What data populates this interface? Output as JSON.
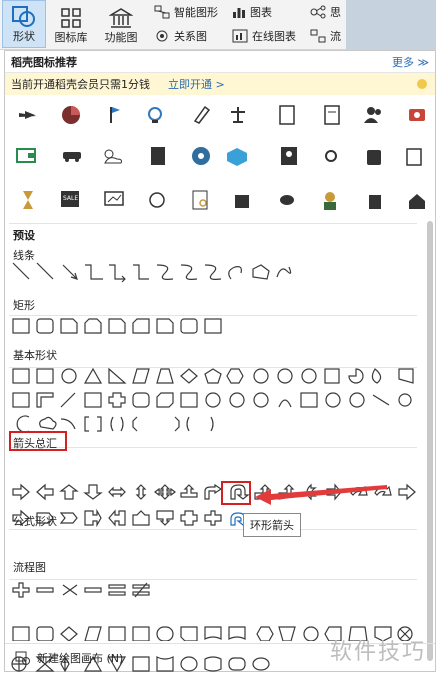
{
  "ribbon": {
    "shape_label": "形状",
    "iconlib_label": "图标库",
    "funcchart_label": "功能图",
    "smartart_label": "智能图形",
    "chart_label": "图表",
    "mindmap_label": "关系图",
    "onlinechart_label": "在线图表",
    "extra1_label": "思",
    "extra2_label": "流"
  },
  "panel": {
    "title": "稻壳图标推荐",
    "more": "更多 ≫",
    "promo_text": "当前开通稻壳会员只需1分钱",
    "promo_link": "立即开通 >",
    "preset_title": "预设",
    "sections": [
      "线条",
      "矩形",
      "基本形状",
      "箭头总汇",
      "公式形状",
      "流程图"
    ],
    "tooltip": "环形箭头",
    "footer": "新建绘图画布 (N)"
  },
  "watermark": "软件技巧",
  "colors": {
    "accent": "#1e6fbf",
    "red": "#d32020",
    "icon": "#333333"
  }
}
